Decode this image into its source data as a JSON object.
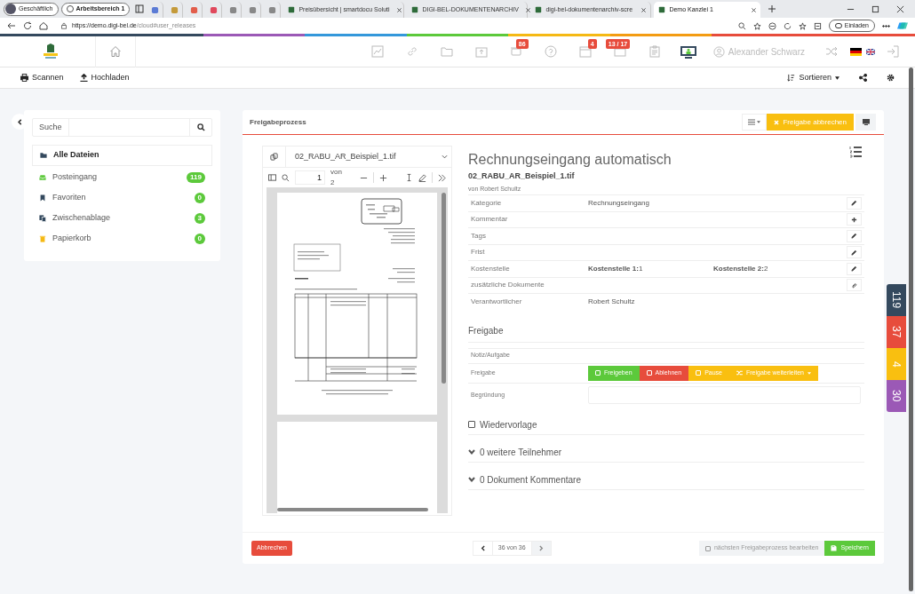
{
  "browser": {
    "profile": "Geschäftlich",
    "workspace": "Arbeitsbereich 1",
    "tabs": [
      {
        "kind": "icon",
        "selected": false
      },
      {
        "kind": "icon",
        "selected": false
      },
      {
        "kind": "icon",
        "selected": false
      },
      {
        "kind": "icon",
        "selected": false
      },
      {
        "kind": "icon",
        "selected": false
      },
      {
        "kind": "icon",
        "selected": false
      },
      {
        "kind": "icon",
        "selected": false
      },
      {
        "kind": "page",
        "label": "Preisübersicht | smartdocu Soluti",
        "selected": false
      },
      {
        "kind": "page",
        "label": "DIGI-BEL-DOKUMENTENARCHIV",
        "selected": false
      },
      {
        "kind": "page",
        "label": "digi-bel-dokumentenarchiv-scre",
        "selected": false
      },
      {
        "kind": "page",
        "label": "Demo Kanzlei 1",
        "selected": true
      }
    ],
    "url_host": "https://demo.digi-bel.de",
    "url_path": "/cloud#user_releases",
    "invite": "Einladen"
  },
  "nav": {
    "messages_badge": "86",
    "calendar_badge": "4",
    "tasks_badge": "13 / 17",
    "user": "Alexander Schwarz"
  },
  "toolbar": {
    "scan": "Scannen",
    "upload": "Hochladen",
    "sort": "Sortieren"
  },
  "sidebar": {
    "search_label": "Suche",
    "items": [
      {
        "label": "Alle Dateien",
        "selected": true,
        "color": "#34495e"
      },
      {
        "label": "Posteingang",
        "count": "119",
        "selected": false,
        "color": "#5cc93b"
      },
      {
        "label": "Favoriten",
        "count": "0",
        "selected": false,
        "color": "#34495e"
      },
      {
        "label": "Zwischenablage",
        "count": "3",
        "selected": false,
        "color": "#34495e"
      },
      {
        "label": "Papierkorb",
        "count": "0",
        "selected": false,
        "color": "#f5b914"
      }
    ]
  },
  "panel": {
    "title": "Freigabeprozess",
    "cancel_release": "Freigabe abbrechen",
    "viewer": {
      "file": "02_RABU_AR_Beispiel_1.tif",
      "page": "1",
      "of_pages": "von 2"
    },
    "document": {
      "title": "Rechnungseingang automatisch",
      "file": "02_RABU_AR_Beispiel_1.tif",
      "author": "von Robert Schultz",
      "rows": [
        {
          "label": "Kategorie",
          "values": [
            "Rechnungseingang"
          ],
          "kind": "edit"
        },
        {
          "label": "Kommentar",
          "kind": "add"
        },
        {
          "label": "Tags",
          "kind": "edit"
        },
        {
          "label": "Frist",
          "kind": "edit"
        },
        {
          "label": "Kostenstelle",
          "values": [
            "**Kostenstelle 1:**1",
            "**Kostenstelle 2:**2"
          ],
          "kind": "edit"
        },
        {
          "label": "zusätzliche Dokumente",
          "kind": "attach"
        },
        {
          "label": "Verantwortlicher",
          "values": [
            "Robert Schultz"
          ],
          "kind": "plain"
        }
      ]
    },
    "release": {
      "heading": "Freigabe",
      "note_label": "Notiz/Aufgabe",
      "release_label": "Freigabe",
      "buttons": [
        {
          "label": "Freigeben",
          "kind": "approve"
        },
        {
          "label": "Ablehnen",
          "kind": "reject"
        },
        {
          "label": "Pause",
          "kind": "pause"
        },
        {
          "label": "Freigabe weiterleiten",
          "kind": "forward"
        }
      ],
      "reason_label": "Begründung"
    },
    "resubmission": {
      "label": "Wiedervorlage",
      "checked": false
    },
    "sections": [
      "0 weitere Teilnehmer",
      "0 Dokument Kommentare"
    ],
    "footer": {
      "cancel": "Abbrechen",
      "pager": "36 von 36",
      "next_label": "nächsten Freigabeprozess bearbeiten",
      "next_checked": false,
      "save": "Speichern"
    }
  },
  "side_tabs": [
    {
      "label": "119",
      "color": "#34495e"
    },
    {
      "label": "37",
      "color": "#e74c3c"
    },
    {
      "label": "4",
      "color": "#f9bf10"
    },
    {
      "label": "30",
      "color": "#9b59b6"
    }
  ]
}
